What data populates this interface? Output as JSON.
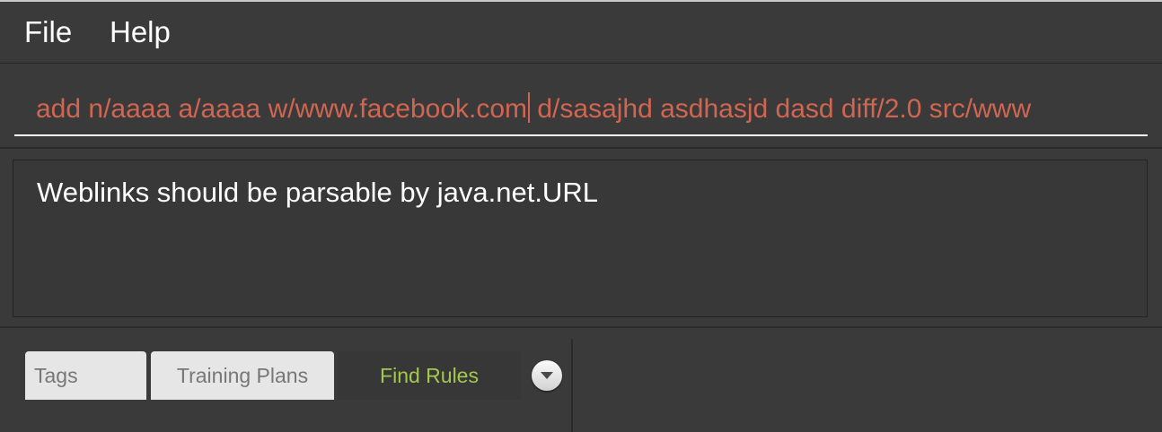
{
  "menu": {
    "file_label": "File",
    "help_label": "Help"
  },
  "command_box": {
    "value_before_caret": "add n/aaaa a/aaaa w/www.facebook.com",
    "value_after_caret": " d/sasajhd asdhasjd dasd diff/2.0 src/www"
  },
  "result_display": {
    "message": "Weblinks should be parsable by java.net.URL"
  },
  "tabs": {
    "items": [
      {
        "label": "Tags",
        "selected": false
      },
      {
        "label": "Training Plans",
        "selected": false
      },
      {
        "label": "Find Rules",
        "selected": true
      }
    ],
    "menu_icon": "chevron-down-icon"
  },
  "colors": {
    "background": "#3a3a3a",
    "command_text": "#d06651",
    "selected_tab_text": "#a2c84e",
    "tab_background": "#e6e6e6",
    "result_text": "#ffffff"
  }
}
